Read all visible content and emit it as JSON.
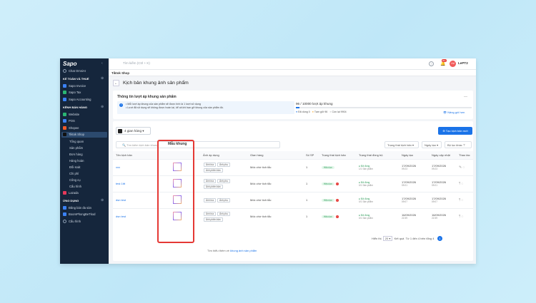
{
  "sidebar": {
    "logo": "Sapo",
    "items": [
      {
        "label": "Chat OmniAI",
        "type": "item",
        "icon": "chat-icon"
      },
      {
        "label": "KẾ TOÁN VÀ THUẾ",
        "type": "head"
      },
      {
        "label": "Sapo Invoice",
        "type": "item",
        "color": "#3b82f6"
      },
      {
        "label": "Sapo Tax",
        "type": "item",
        "color": "#2bb673"
      },
      {
        "label": "Sapo Accounting",
        "type": "item",
        "color": "#3b82f6"
      },
      {
        "label": "KÊNH BÁN HÀNG",
        "type": "head"
      },
      {
        "label": "Website",
        "type": "item",
        "color": "#2bb673"
      },
      {
        "label": "POS",
        "type": "item",
        "color": "#3b82f6"
      },
      {
        "label": "Shopee",
        "type": "item",
        "color": "#f05a28"
      },
      {
        "label": "Tiktok Shop",
        "type": "item",
        "color": "#111111",
        "active": true
      },
      {
        "label": "Tổng quan",
        "type": "sub"
      },
      {
        "label": "Sản phẩm",
        "type": "sub"
      },
      {
        "label": "Đơn hàng",
        "type": "sub"
      },
      {
        "label": "Hàng hoàn",
        "type": "sub"
      },
      {
        "label": "Đối soát",
        "type": "sub"
      },
      {
        "label": "Chi phí",
        "type": "sub"
      },
      {
        "label": "Công cụ",
        "type": "sub"
      },
      {
        "label": "Cấu hình",
        "type": "sub"
      },
      {
        "label": "Lazada",
        "type": "item",
        "color": "#e5395a"
      },
      {
        "label": "ỨNG DỤNG",
        "type": "head"
      },
      {
        "label": "Đăng bán đa sàn",
        "type": "item",
        "color": "#3b82f6"
      },
      {
        "label": "BoomPhongBeTkod",
        "type": "item",
        "color": "#3b82f6"
      },
      {
        "label": "Cấu hình",
        "type": "item",
        "icon": "gear-icon"
      }
    ]
  },
  "topbar": {
    "search_placeholder": "Tìm kiếm (Ctrl + K)",
    "notif_count": "99+",
    "avatar": "LM",
    "user": "LePT2"
  },
  "subbar": {
    "title": "Tiktok Shop"
  },
  "page": {
    "title": "Kịch bản khung ảnh sản phẩm"
  },
  "quota_card": {
    "heading": "Thông tin lượt áp khung sản phẩm",
    "info1": "Mỗi lượt áp khung của sản phẩm sẽ được tính là 1 lượt sử dụng",
    "info2": "Lượt đã sử dụng sẽ không được hoàn lại, kể cả khi bạn gỡ khung của sản phẩm đó.",
    "quota": "96 / 10000 lượt áp khung",
    "quota_fraction": 0.0096,
    "used": "Đã dùng 0",
    "temp": "Tạm giữ 96",
    "remaining": "Còn lại 9904",
    "upgrade": "Nâng gói hơn"
  },
  "toolbar": {
    "store": "4 gian hàng",
    "create": "Tạo kịch bản mới"
  },
  "filters": {
    "search": "Tìm kiếm kịch bản khung",
    "status": "Trạng thái kịch bản",
    "date": "Ngày tạo",
    "other": "Bộ lọc khác"
  },
  "highlight_title": "Mẫu khung",
  "columns": [
    "Tên kịch bản",
    "",
    "Ảnh áp dụng",
    "Gian hàng",
    "Số SP",
    "Trạng thái kịch bản",
    "Trạng thái đồng bộ",
    "Ngày tạo",
    "Ngày cập nhật",
    "Thao tác"
  ],
  "rows": [
    {
      "name": "xxx",
      "tags": [
        "Ảnh bìa",
        "Ảnh phụ",
        "Ảnh phiên bản"
      ],
      "store": "Mốc chờ tích tắc",
      "count": "1",
      "status": "Hiệu lực",
      "sync": "Đã đồng",
      "sync_sub": "1/1 Sản phẩm",
      "created": "17/09/2026",
      "created_t": "09:23",
      "updated": "17/09/2026",
      "updated_t": "09:23",
      "warn": false
    },
    {
      "name": "test 1ttt",
      "tags": [
        "Ảnh bìa",
        "Ảnh phụ",
        "Ảnh phiên bản"
      ],
      "store": "Mốc chờ tích tắc",
      "count": "1",
      "status": "Hiệu lực",
      "sync": "Đã đồng",
      "sync_sub": "0/1 Sản phẩm",
      "created": "17/09/2026",
      "created_t": "09:21",
      "updated": "17/09/2026",
      "updated_t": "09:21",
      "warn": true
    },
    {
      "name": "dsn test",
      "tags": [
        "Ảnh bìa",
        "Ảnh phụ"
      ],
      "store": "Mốc chờ tích tắc",
      "count": "1",
      "status": "Hiệu lực",
      "sync": "Đã đồng",
      "sync_sub": "0/1 Sản phẩm",
      "created": "17/09/2026",
      "created_t": "09:07",
      "updated": "17/09/2026",
      "updated_t": "09:07",
      "warn": true
    },
    {
      "name": "dsn test",
      "tags": [
        "Ảnh bìa",
        "Ảnh phụ",
        "Ảnh phiên bản"
      ],
      "store": "Mốc chờ tích tắc",
      "count": "1",
      "status": "Hiệu lực",
      "sync": "Đã đồng",
      "sync_sub": "0/1 Sản phẩm",
      "created": "16/09/2026",
      "created_t": "22:39",
      "updated": "16/09/2026",
      "updated_t": "22:39",
      "warn": true
    }
  ],
  "pager": {
    "label": "Hiển thị",
    "size": "20",
    "result": "Kết quả",
    "range": "Từ 1 đến 4 trên tổng 4",
    "page": "1"
  },
  "footer": "Tìm hiểu thêm về khung ảnh sản phẩm"
}
